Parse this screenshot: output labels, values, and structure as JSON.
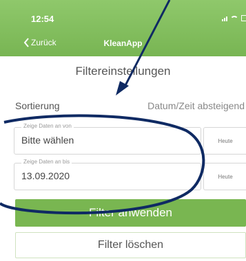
{
  "status_bar": {
    "time": "12:54"
  },
  "nav": {
    "back_label": "Zurück",
    "app_title": "KleanApp"
  },
  "page": {
    "title": "Filtereinstellungen"
  },
  "sorting": {
    "label": "Sortierung",
    "value": "Datum/Zeit absteigend"
  },
  "filter_from": {
    "legend": "Zeige Daten an von",
    "value": "Bitte wählen",
    "today_label": "Heute"
  },
  "filter_to": {
    "legend": "Zeige Daten an bis",
    "value": "13.09.2020",
    "today_label": "Heute"
  },
  "actions": {
    "apply_label": "Filter anwenden",
    "clear_label": "Filter löschen"
  },
  "colors": {
    "accent_green": "#79b651",
    "annotation_navy": "#0f2a63"
  }
}
